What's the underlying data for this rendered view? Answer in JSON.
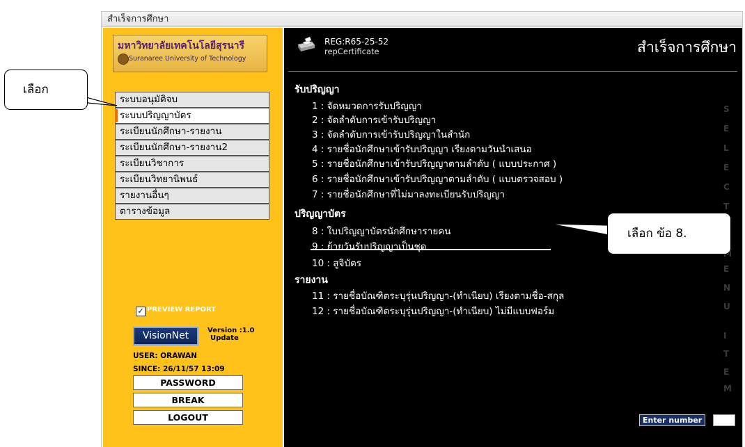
{
  "window": {
    "title": "สำเร็จการศึกษา"
  },
  "logo": {
    "name_th": "มหาวิทยาลัยเทคโนโลยีสุรนารี",
    "name_en": "Suranaree University of Technology"
  },
  "menu": {
    "items": [
      {
        "label": "ระบบอนุมัติจบ"
      },
      {
        "label": "ระบบปริญญาบัตร",
        "active": true
      },
      {
        "label": "ระเบียนนักศึกษา-รายงาน"
      },
      {
        "label": "ระเบียนนักศึกษา-รายงาน2"
      },
      {
        "label": "ระเบียนวิชาการ"
      },
      {
        "label": "ระเบียนวิทยานิพนธ์"
      },
      {
        "label": "รายงานอื่นๆ"
      },
      {
        "label": "ตารางข้อมูล"
      }
    ]
  },
  "preview_report": {
    "label": "PREVIEW REPORT",
    "checked": true,
    "mark": "✓"
  },
  "brand": {
    "logo_text": "VisionNet",
    "version": "Version :1.0",
    "update": "Update"
  },
  "session": {
    "user": "USER: ORAWAN",
    "since": "SINCE: 26/11/57 13:09"
  },
  "buttons": {
    "password": "PASSWORD",
    "break": "BREAK",
    "logout": "LOGOUT"
  },
  "header": {
    "code": "REG:R65-25-52",
    "report": "repCertificate",
    "title": "สำเร็จการศึกษา"
  },
  "sections": {
    "receive": {
      "title": "รับปริญญา",
      "items": [
        "1 : จัดหมวดการรับปริญญา",
        "2 : จัดลำดับการเข้ารับปริญญา",
        "3 : จัดลำดับการเข้ารับปริญญาในสำนัก",
        "4 : รายชื่อนักศึกษาเข้ารับปริญญา เรียงตามวันนำเสนอ",
        "5 : รายชื่อนักศึกษาเข้ารับปริญญาตามลำดับ ( แบบประกาศ )",
        "6 : รายชื่อนักศึกษาเข้ารับปริญญาตามลำดับ ( แบบตรวจสอบ )",
        "7 : รายชื่อนักศึกษาที่ไม่มาลงทะเบียนรับปริญญา"
      ]
    },
    "certificate": {
      "title": "ปริญญาบัตร",
      "items": [
        "8 : ใบปริญญาบัตรนักศึกษารายคน",
        "9 : ย้ายวันรับปริญญาเป็นชุด",
        "10 : สูจิบัตร"
      ]
    },
    "report": {
      "title": "รายงาน",
      "items": [
        "11 : รายชื่อบัณฑิตระบุรุ่นปริญญา-(ทำเนียบ) เรียงตามชื่อ-สกุล",
        "12 : รายชื่อบัณฑิตระบุรุ่นปริญญา-(ทำเนียบ) ไม่มีแบบฟอร์ม"
      ]
    }
  },
  "side_watermark": [
    "S",
    "E",
    "L",
    "E",
    "C",
    "T",
    "M",
    "E",
    "N",
    "U",
    "I",
    "T",
    "E",
    "M"
  ],
  "enter_number": {
    "label": "Enter number",
    "value": ""
  },
  "callouts": {
    "left": "เลือก",
    "right": "เลือก ข้อ 8."
  },
  "colors": {
    "left_panel": "#ffc21a",
    "right_panel": "#000000",
    "active_marker": "#ff6a00"
  }
}
